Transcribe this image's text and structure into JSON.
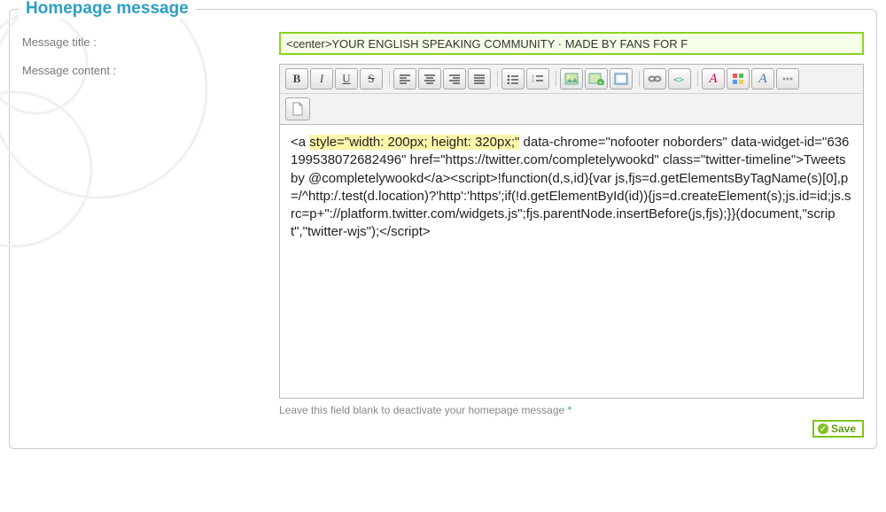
{
  "section": {
    "title": "Homepage message"
  },
  "labels": {
    "title": "Message title :",
    "content": "Message content :"
  },
  "fields": {
    "title_value": "<center>YOUR ENGLISH SPEAKING COMMUNITY · MADE BY FANS FOR F",
    "content_pre": "<a ",
    "content_hl": "style=\"width: 200px; height: 320px;\"",
    "content_post": " data-chrome=\"nofooter noborders\" data-widget-id=\"636199538072682496\" href=\"https://twitter.com/completelywookd\" class=\"twitter-timeline\">Tweets by @completelywookd</a><script>!function(d,s,id){var js,fjs=d.getElementsByTagName(s)[0],p=/^http:/.test(d.location)?'http':'https';if(!d.getElementById(id)){js=d.createElement(s);js.id=id;js.src=p+\"://platform.twitter.com/widgets.js\";fjs.parentNode.insertBefore(js,fjs);}}(document,\"script\",\"twitter-wjs\");</script>"
  },
  "hint": {
    "text": "Leave this field blank to deactivate your homepage message ",
    "ast": "*"
  },
  "buttons": {
    "save": "Save"
  },
  "toolbar": {
    "bold": "B",
    "italic": "I",
    "underline": "U",
    "strike": "S",
    "align_left": "align-left",
    "align_center": "align-center",
    "align_right": "align-right",
    "align_just": "align-justify",
    "ul": "unordered-list",
    "ol": "ordered-list",
    "img": "image",
    "img_add": "image-add",
    "img_frame": "image-frame",
    "link": "link",
    "code": "code",
    "fx1": "text-style-a",
    "fx2": "palette",
    "fx3": "text-style-b",
    "fx4": "more",
    "doc": "document"
  }
}
